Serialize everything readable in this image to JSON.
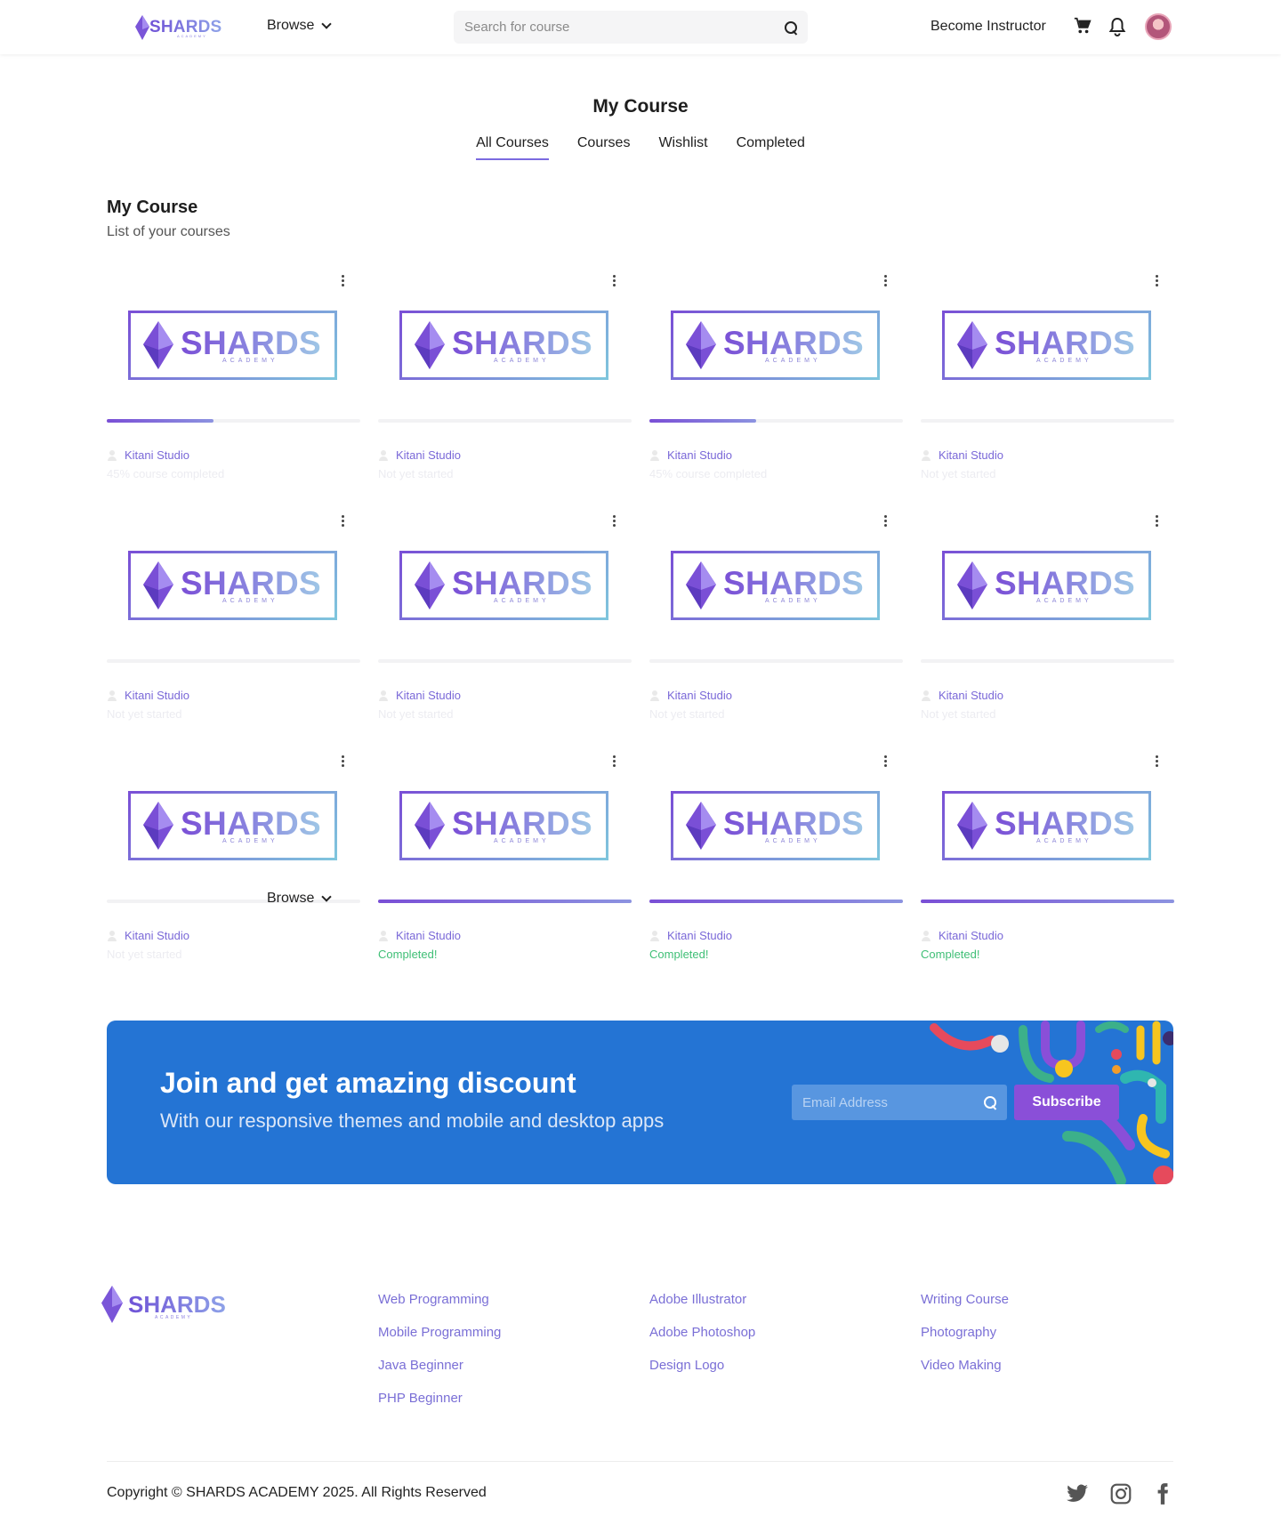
{
  "header": {
    "logo_text": "SHARDS",
    "logo_sub": "ACADEMY",
    "browse_label": "Browse",
    "search_placeholder": "Search for course",
    "become_instructor": "Become Instructor"
  },
  "page": {
    "title": "My Course",
    "tabs": [
      {
        "label": "All Courses",
        "active": true
      },
      {
        "label": "Courses",
        "active": false
      },
      {
        "label": "Wishlist",
        "active": false
      },
      {
        "label": "Completed",
        "active": false
      }
    ]
  },
  "section": {
    "title": "My Course",
    "subtitle": "List of your courses"
  },
  "course_brand": {
    "word": "SHARDS",
    "sub": "ACADEMY"
  },
  "courses": [
    {
      "author": "Kitani Studio",
      "status": "45% course completed",
      "progress": 0.42,
      "completed": false
    },
    {
      "author": "Kitani Studio",
      "status": "Not yet started",
      "progress": 0,
      "completed": false
    },
    {
      "author": "Kitani Studio",
      "status": "45% course completed",
      "progress": 0.42,
      "completed": false
    },
    {
      "author": "Kitani Studio",
      "status": "Not yet started",
      "progress": 0,
      "completed": false
    },
    {
      "author": "Kitani Studio",
      "status": "Not yet started",
      "progress": 0,
      "completed": false
    },
    {
      "author": "Kitani Studio",
      "status": "Not yet started",
      "progress": 0,
      "completed": false
    },
    {
      "author": "Kitani Studio",
      "status": "Not yet started",
      "progress": 0,
      "completed": false
    },
    {
      "author": "Kitani Studio",
      "status": "Not yet started",
      "progress": 0,
      "completed": false
    },
    {
      "author": "Kitani Studio",
      "status": "Not yet started",
      "progress": 0,
      "completed": false
    },
    {
      "author": "Kitani Studio",
      "status": "Completed!",
      "progress": 1,
      "completed": true
    },
    {
      "author": "Kitani Studio",
      "status": "Completed!",
      "progress": 1,
      "completed": true
    },
    {
      "author": "Kitani Studio",
      "status": "Completed!",
      "progress": 1,
      "completed": true
    }
  ],
  "floating_browse_label": "Browse",
  "banner": {
    "title": "Join and get amazing discount",
    "subtitle": "With our responsive themes and mobile and desktop apps",
    "email_placeholder": "Email Address",
    "subscribe_label": "Subscribe"
  },
  "footer": {
    "logo_text": "SHARDS",
    "logo_sub": "ACADEMY",
    "columns": [
      [
        "Web Programming",
        "Mobile Programming",
        "Java Beginner",
        "PHP Beginner"
      ],
      [
        "Adobe Illustrator",
        "Adobe Photoshop",
        "Design Logo"
      ],
      [
        "Writing Course",
        "Photography",
        "Video Making"
      ]
    ],
    "copyright": "Copyright © SHARDS ACADEMY 2025. All Rights Reserved",
    "social": [
      "twitter-icon",
      "instagram-icon",
      "facebook-icon"
    ]
  },
  "colors": {
    "accent": "#7a4fd6",
    "banner_bg": "#2474d4",
    "completed": "#3fbf76",
    "link": "#7a6fd6"
  }
}
